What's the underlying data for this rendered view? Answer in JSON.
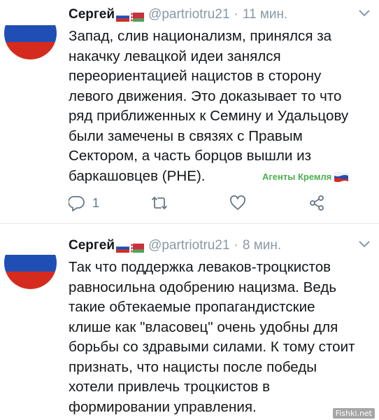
{
  "tweets": [
    {
      "name": "Сергей",
      "handle": "@partriotru21",
      "time_sep": "·",
      "time": "11 мин.",
      "lines": [
        "Запад, слив национализм, принялся за",
        "накачку левацкой идеи занялся",
        "переориентацией нацистов в сторону",
        "левого движения. Это доказывает то что",
        "ряд приближенных к Семину и Удальцову",
        "были замечены в связях с Правым",
        "Сектором, а часть борцов вышли из",
        "баркашовцев (РНЕ)."
      ],
      "reply_count": "1"
    },
    {
      "name": "Сергей",
      "handle": "@partriotru21",
      "time_sep": "·",
      "time": "8 мин.",
      "lines": [
        "Так что поддержка леваков-троцкистов",
        "равносильна одобрению нацизма. Ведь",
        "такие обтекаемые пропагандистские",
        "клише как \"власовец\" очень удобны для",
        "борьбы со здравыми силами. К тому стоит",
        "признать, что нацисты после победы",
        "хотели привлечь троцкистов в",
        "формировании управления."
      ]
    }
  ],
  "stamp": "Агенты Кремля",
  "watermark": "Fishki.net",
  "colors": {
    "text": "#14171a",
    "secondary": "#8899a6",
    "icon": "#657786",
    "stamp": "#4caf50",
    "flag_ru": [
      "#ffffff",
      "#1f4fb5",
      "#d52b1e"
    ],
    "flag_by": [
      "#c8313e",
      "#4aa657"
    ]
  },
  "icons": [
    "reply-icon",
    "retweet-icon",
    "like-icon",
    "share-icon",
    "chevron-down-icon"
  ]
}
